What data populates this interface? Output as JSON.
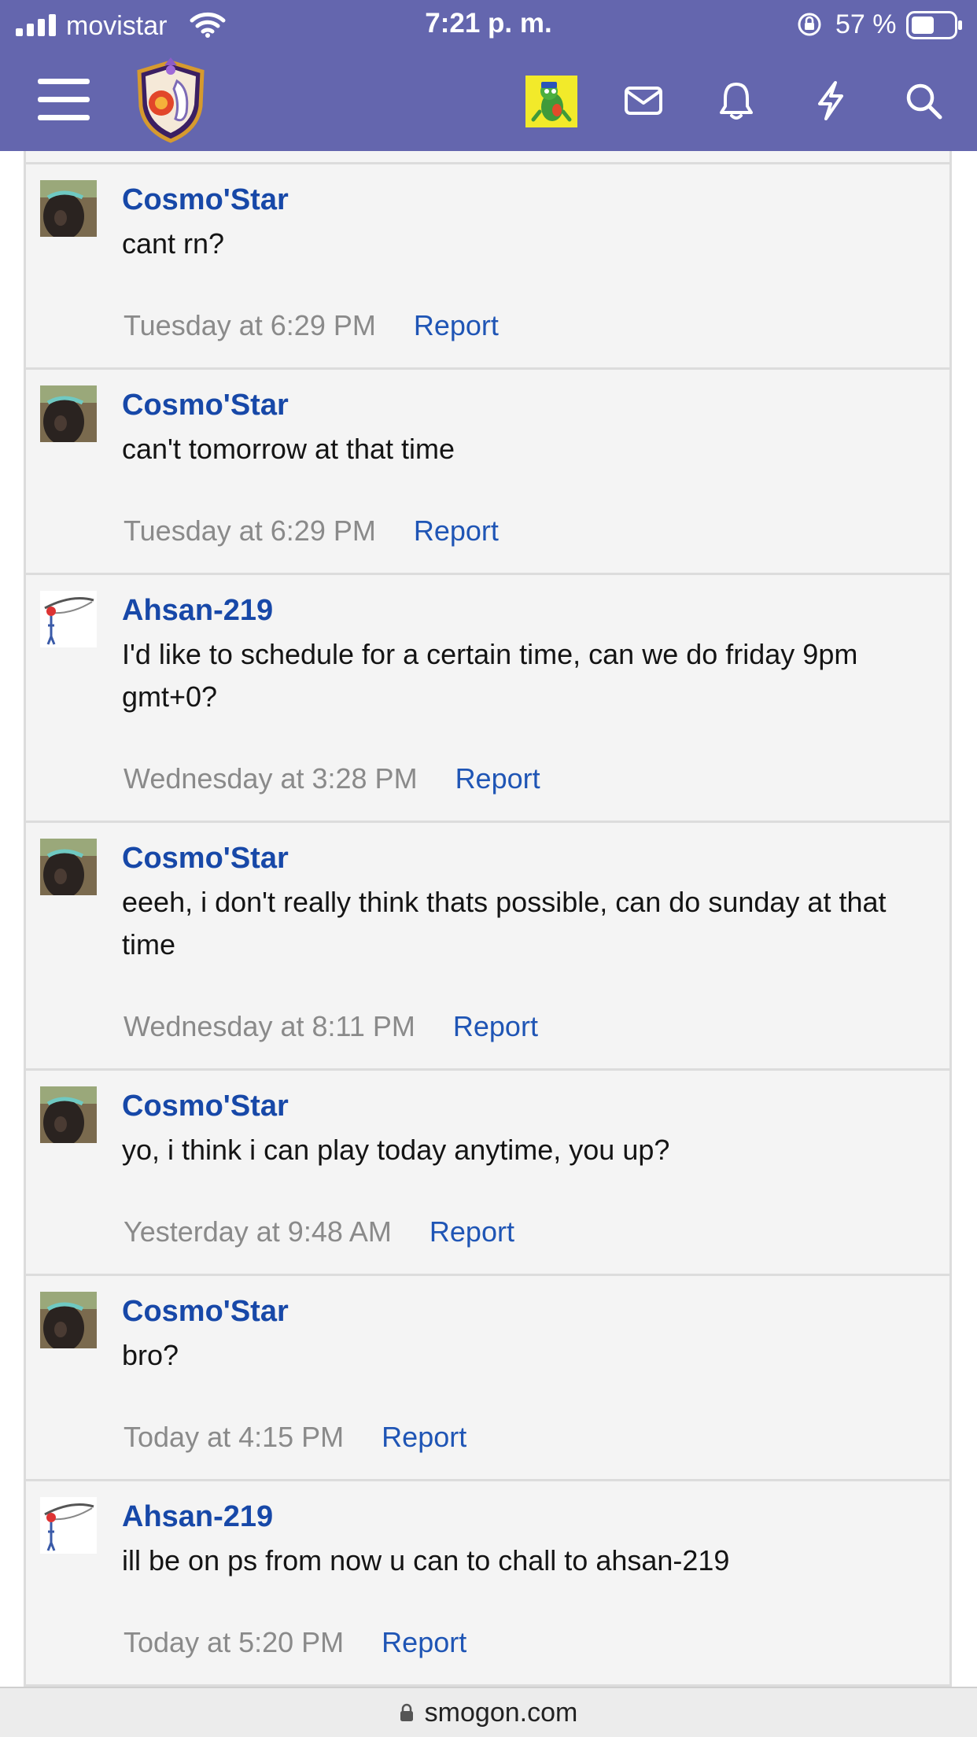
{
  "status_bar": {
    "carrier": "movistar",
    "time": "7:21 p. m.",
    "battery_percent": "57 %"
  },
  "nav": {
    "icons": [
      "menu-icon",
      "site-logo",
      "user-avatar",
      "mail-icon",
      "bell-icon",
      "bolt-icon",
      "search-icon"
    ]
  },
  "messages": [
    {
      "user": "Cosmo'Star",
      "text": "cant rn?",
      "time": "Tuesday at 6:29 PM",
      "report": "Report"
    },
    {
      "user": "Cosmo'Star",
      "text": "can't tomorrow at that time",
      "time": "Tuesday at 6:29 PM",
      "report": "Report"
    },
    {
      "user": "Ahsan-219",
      "text": "I'd like to schedule for a certain time, can we do friday 9pm gmt+0?",
      "time": "Wednesday at 3:28 PM",
      "report": "Report"
    },
    {
      "user": "Cosmo'Star",
      "text": "eeeh, i don't really think thats possible, can do sunday at that time",
      "time": "Wednesday at 8:11 PM",
      "report": "Report"
    },
    {
      "user": "Cosmo'Star",
      "text": "yo, i think i can play today anytime, you up?",
      "time": "Yesterday at 9:48 AM",
      "report": "Report"
    },
    {
      "user": "Cosmo'Star",
      "text": "bro?",
      "time": "Today at 4:15 PM",
      "report": "Report"
    },
    {
      "user": "Ahsan-219",
      "text": "ill be on ps from now u can to chall to ahsan-219",
      "time": "Today at 5:20 PM",
      "report": "Report"
    }
  ],
  "url_bar": {
    "domain": "smogon.com"
  },
  "colors": {
    "header": "#6466ae",
    "username": "#1748a8",
    "link": "#1f55b5",
    "timestamp": "#8a8a8a",
    "background": "#f4f4f4"
  }
}
